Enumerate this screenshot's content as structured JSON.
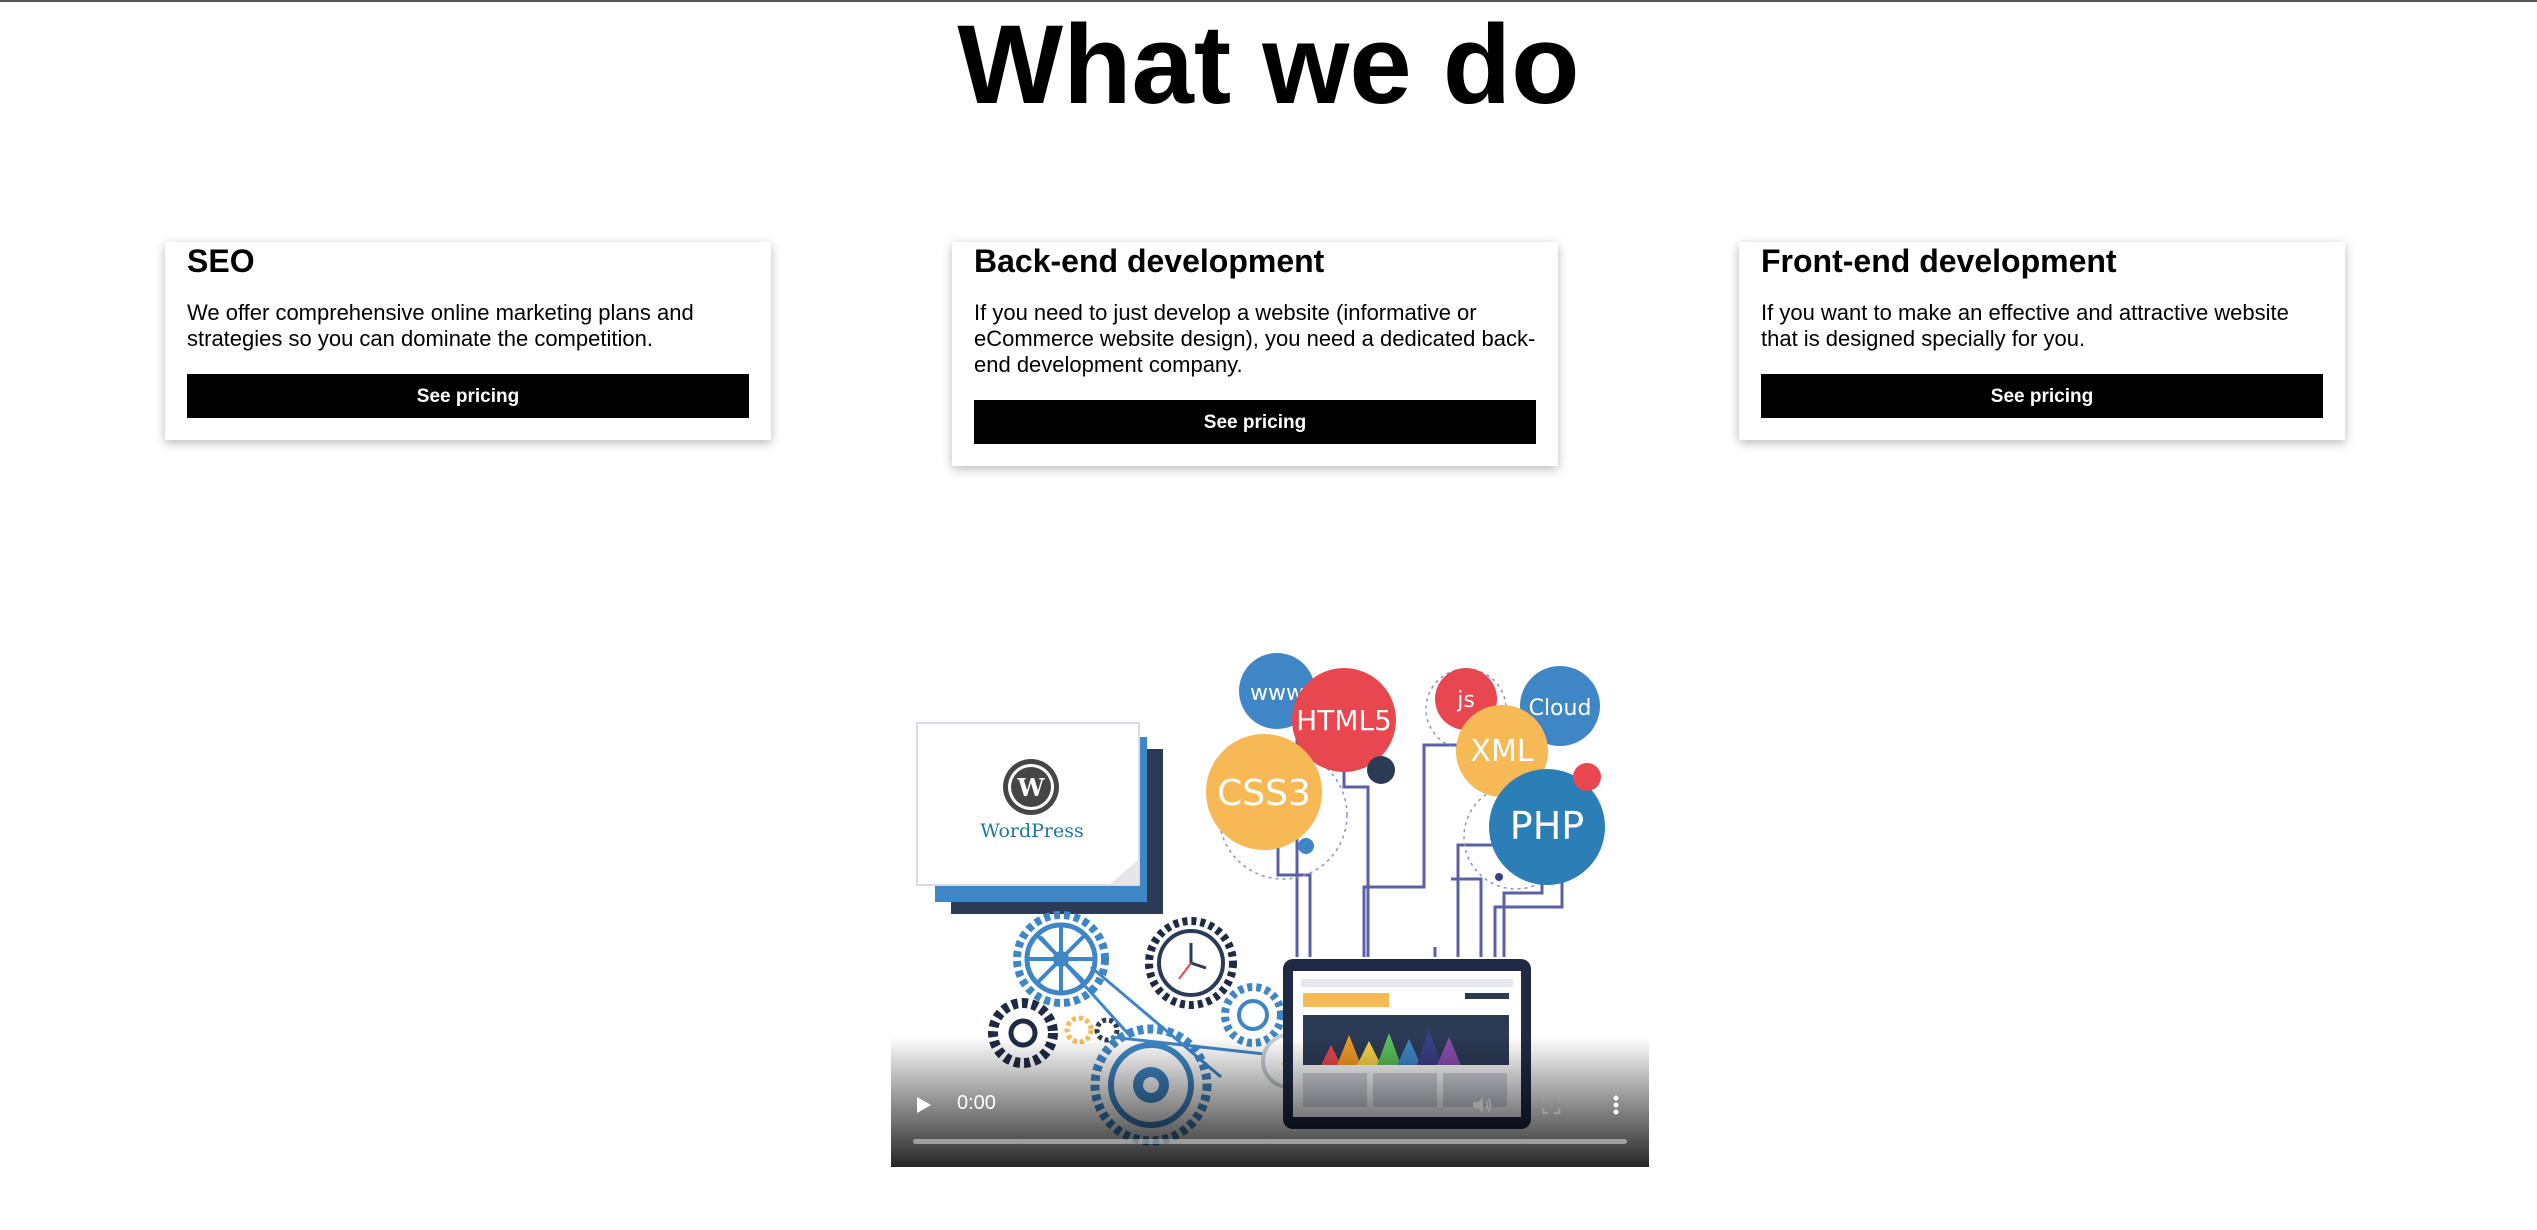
{
  "header": {
    "title": "What we do"
  },
  "services": [
    {
      "title": "SEO",
      "description": "We offer comprehensive online marketing plans and strategies so you can dominate the competition.",
      "button_label": "See pricing"
    },
    {
      "title": "Back-end development",
      "description": "If you need to just develop a website (informative or eCommerce website design), you need a dedicated back-end development company.",
      "button_label": "See pricing"
    },
    {
      "title": "Front-end development",
      "description": "If you want to make an effective and attractive website that is designed specially for you.",
      "button_label": "See pricing"
    }
  ],
  "video": {
    "time": "0:00",
    "progress": 0,
    "illustration_labels": {
      "www": "www",
      "html5": "HTML5",
      "js": "js",
      "cloud": "Cloud",
      "css3": "CSS3",
      "xml": "XML",
      "php": "PHP",
      "wordpress": "WordPress"
    },
    "icons": [
      "play-icon",
      "volume-icon",
      "fullscreen-icon",
      "more-options-icon"
    ]
  },
  "colors": {
    "button_bg": "#000000",
    "button_text": "#ffffff",
    "html5_red": "#e8474f",
    "css3_orange": "#f7b955",
    "php_blue": "#2b7fb6",
    "cloud_blue": "#3f86c6",
    "wordpress_dark": "#2b3a55"
  }
}
